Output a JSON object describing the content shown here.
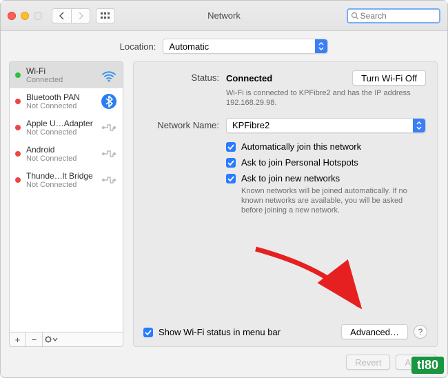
{
  "window": {
    "title": "Network"
  },
  "search": {
    "placeholder": "Search"
  },
  "location": {
    "label": "Location:",
    "value": "Automatic"
  },
  "sidebar": {
    "items": [
      {
        "name": "Wi-Fi",
        "status": "Connected",
        "dot": "green",
        "icon": "wifi"
      },
      {
        "name": "Bluetooth PAN",
        "status": "Not Connected",
        "dot": "red",
        "icon": "bluetooth"
      },
      {
        "name": "Apple U…Adapter",
        "status": "Not Connected",
        "dot": "red",
        "icon": "generic"
      },
      {
        "name": "Android",
        "status": "Not Connected",
        "dot": "red",
        "icon": "generic"
      },
      {
        "name": "Thunde…lt Bridge",
        "status": "Not Connected",
        "dot": "red",
        "icon": "generic"
      }
    ]
  },
  "detail": {
    "status_label": "Status:",
    "status_value": "Connected",
    "turn_off": "Turn Wi-Fi Off",
    "status_sub": "Wi-Fi is connected to KPFibre2 and has the IP address 192.168.29.98.",
    "network_name_label": "Network Name:",
    "network_name_value": "KPFibre2",
    "auto_join": "Automatically join this network",
    "ask_hotspot": "Ask to join Personal Hotspots",
    "ask_new": "Ask to join new networks",
    "ask_new_help": "Known networks will be joined automatically. If no known networks are available, you will be asked before joining a new network.",
    "show_status": "Show Wi-Fi status in menu bar",
    "advanced": "Advanced…"
  },
  "footer": {
    "revert": "Revert",
    "apply": "Apply"
  },
  "watermark": "tI80"
}
